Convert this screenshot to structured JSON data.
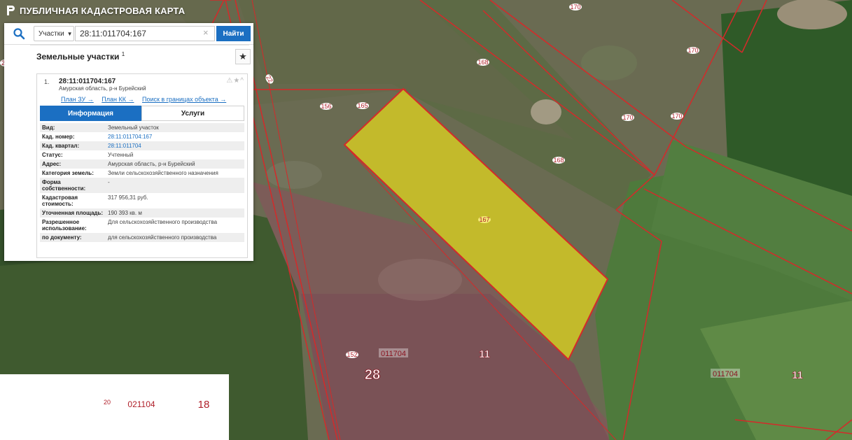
{
  "app": {
    "title": "ПУБЛИЧНАЯ КАДАСТРОВАЯ КАРТА"
  },
  "search": {
    "type_label": "Участки",
    "query": "28:11:011704:167",
    "button_label": "Найти"
  },
  "results": {
    "title": "Земельные участки",
    "count": "1",
    "item": {
      "index": "1.",
      "cad_number": "28:11:011704:167",
      "address_short": "Амурская область, р-н Бурейский",
      "links": [
        "План ЗУ →",
        "План КК →",
        "Поиск в границах объекта →"
      ],
      "tabs": [
        "Информация",
        "Услуги"
      ],
      "props": [
        {
          "key": "Вид:",
          "value": "Земельный участок"
        },
        {
          "key": "Кад. номер:",
          "value": "28:11:011704:167"
        },
        {
          "key": "Кад. квартал:",
          "value": "28:11:011704"
        },
        {
          "key": "Статус:",
          "value": "Учтенный"
        },
        {
          "key": "Адрес:",
          "value": "Амурская область, р-н Бурейский"
        },
        {
          "key": "Категория земель:",
          "value": "Земли сельскохозяйственного назначения"
        },
        {
          "key": "Форма собственности:",
          "value": "-"
        },
        {
          "key": "Кадастровая стоимость:",
          "value": "317 956,31 руб."
        },
        {
          "key": "Уточненная площадь:",
          "value": "190 393 кв. м"
        },
        {
          "key": "Разрешенное использование:",
          "value": "Для сельскохозяйственного производства"
        },
        {
          "key": "по документу:",
          "value": "для сельскохозяйственного производства"
        }
      ]
    }
  },
  "map": {
    "parcel_labels": [
      "170",
      "170",
      "170",
      "170",
      "168",
      "168",
      "165",
      "156",
      "152",
      "22",
      "20",
      "167"
    ],
    "quarter_labels": [
      "011704",
      "011704",
      "021104",
      "021104",
      "20"
    ],
    "district_labels": [
      "11",
      "11",
      "28",
      "18"
    ],
    "colors": {
      "boundary": "#d42a2a",
      "selected_fill": "#e6d81c",
      "link": "#1b6fc2"
    }
  }
}
